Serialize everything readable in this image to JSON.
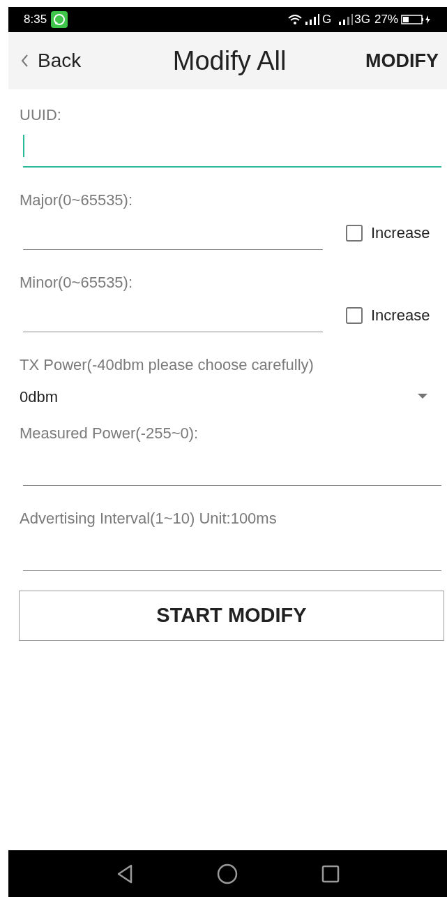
{
  "status_bar": {
    "time": "8:35",
    "network_1": "G",
    "network_2": "3G",
    "battery": "27%"
  },
  "header": {
    "back": "Back",
    "title": "Modify All",
    "action": "MODIFY"
  },
  "fields": [
    {
      "kind": "text",
      "label": "UUID:",
      "focused": true
    },
    {
      "kind": "checkbox_field",
      "label": "Major(0~65535):",
      "checkbox_label": "Increase",
      "checked": false
    },
    {
      "kind": "checkbox_field",
      "label": "Minor(0~65535):",
      "checkbox_label": "Increase",
      "checked": false
    },
    {
      "kind": "spinner",
      "label": "TX Power(-40dbm please choose carefully)",
      "value": "0dbm"
    },
    {
      "kind": "text",
      "label": "Measured Power(-255~0):",
      "focused": false
    },
    {
      "kind": "text",
      "label": "Advertising Interval(1~10) Unit:100ms",
      "focused": false
    }
  ],
  "button": "START MODIFY"
}
